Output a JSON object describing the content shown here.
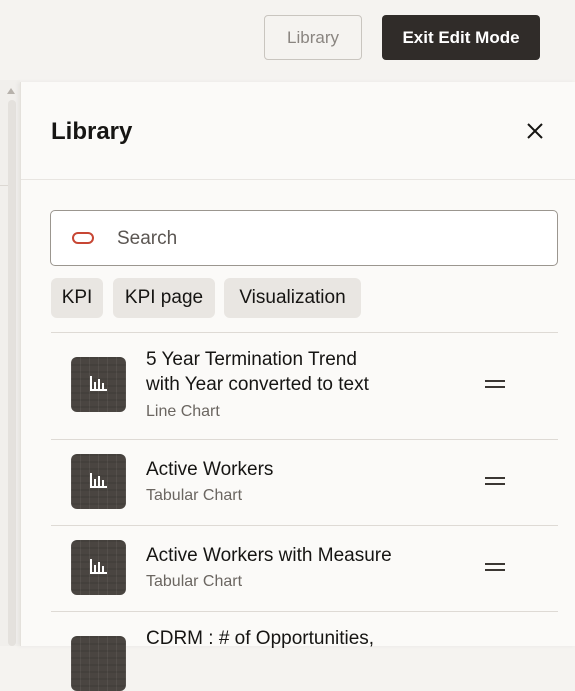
{
  "toolbar": {
    "library_button": "Library",
    "exit_button": "Exit Edit Mode"
  },
  "panel": {
    "title": "Library",
    "search_placeholder": "Search",
    "chips": [
      "KPI",
      "KPI page",
      "Visualization"
    ]
  },
  "items": [
    {
      "title_line1": "5 Year Termination Trend",
      "title_line2": "with Year converted to text",
      "subtitle": "Line Chart",
      "icon": "bar-chart-icon"
    },
    {
      "title_line1": "Active Workers",
      "subtitle": "Tabular Chart",
      "icon": "bar-chart-icon"
    },
    {
      "title_line1": "Active Workers with Measure",
      "subtitle": "Tabular Chart",
      "icon": "bar-chart-icon"
    },
    {
      "title_line1": "CDRM : # of Opportunities,",
      "icon": "bar-chart-icon"
    }
  ],
  "colors": {
    "accent_dark": "#302c29",
    "search_icon": "#c74634",
    "thumb_bg": "#4a4541"
  }
}
